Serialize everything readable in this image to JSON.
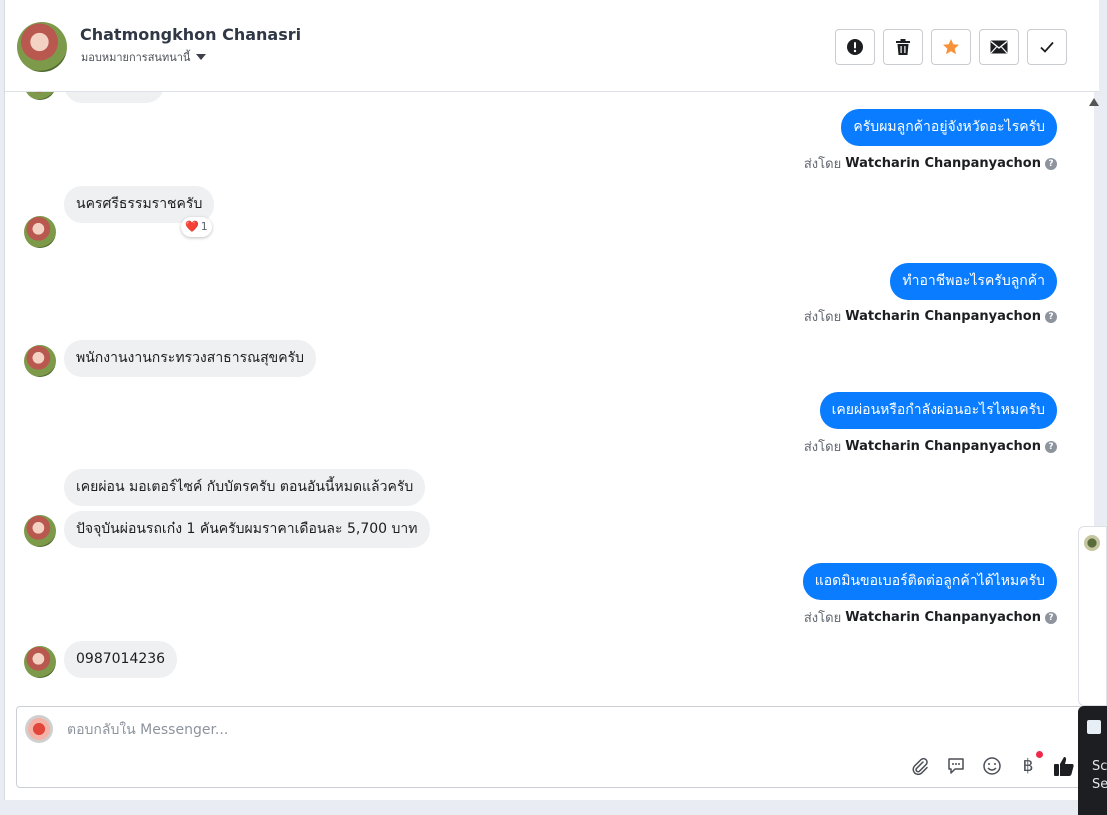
{
  "header": {
    "contact_name": "Chatmongkhon Chanasri",
    "assign_label": "มอบหมายการสนทนานี้"
  },
  "messages": [
    {
      "id": "m1",
      "direction": "out",
      "text": "ครับผมลูกค้าอยู่จังหวัดอะไรครับ",
      "sent_by_label": "ส่งโดย",
      "sender": "Watcharin Chanpanyachon"
    },
    {
      "id": "m2",
      "direction": "in",
      "text": "นครศรีธรรมราชครับ",
      "reaction": {
        "emoji": "❤️",
        "count": "1"
      }
    },
    {
      "id": "m3",
      "direction": "out",
      "text": "ทำอาชีพอะไรครับลูกค้า",
      "sent_by_label": "ส่งโดย",
      "sender": "Watcharin Chanpanyachon"
    },
    {
      "id": "m4",
      "direction": "in",
      "text": "พนักงานงานกระทรวงสาธารณสุขครับ"
    },
    {
      "id": "m5",
      "direction": "out",
      "text": "เคยผ่อนหรือกำลังผ่อนอะไรไหมครับ",
      "sent_by_label": "ส่งโดย",
      "sender": "Watcharin Chanpanyachon"
    },
    {
      "id": "m6",
      "direction": "in",
      "text": "เคยผ่อน มอเตอร์ไซค์ กับบัตรครับ ตอนอันนี้หมดแล้วครับ"
    },
    {
      "id": "m7",
      "direction": "in",
      "text": "ปัจจุบันผ่อนรถเก๋ง 1 คันครับผมราคาเดือนละ 5,700 บาท"
    },
    {
      "id": "m8",
      "direction": "out",
      "text": "แอดมินขอเบอร์ติดต่อลูกค้าได้ไหมครับ",
      "sent_by_label": "ส่งโดย",
      "sender": "Watcharin Chanpanyachon"
    },
    {
      "id": "m9",
      "direction": "in",
      "text": "0987014236"
    }
  ],
  "composer": {
    "placeholder": "ตอบกลับใน Messenger..."
  },
  "side_panel": {
    "text_line1": "Sc",
    "text_line2": "Se"
  },
  "icons": {
    "report": "exclamation-circle-icon",
    "delete": "trash-icon",
    "star": "star-icon",
    "mail": "envelope-icon",
    "done": "checkmark-icon",
    "attach": "paperclip-icon",
    "saved_replies": "chat-bubble-icon",
    "emoji": "smiley-icon",
    "payment": "baht-icon",
    "like": "thumbs-up-icon"
  },
  "colors": {
    "outgoing_bubble": "#0a7cff",
    "incoming_bubble": "#eef0f2",
    "star_active": "#f7923a",
    "notification_dot": "#f02849"
  }
}
